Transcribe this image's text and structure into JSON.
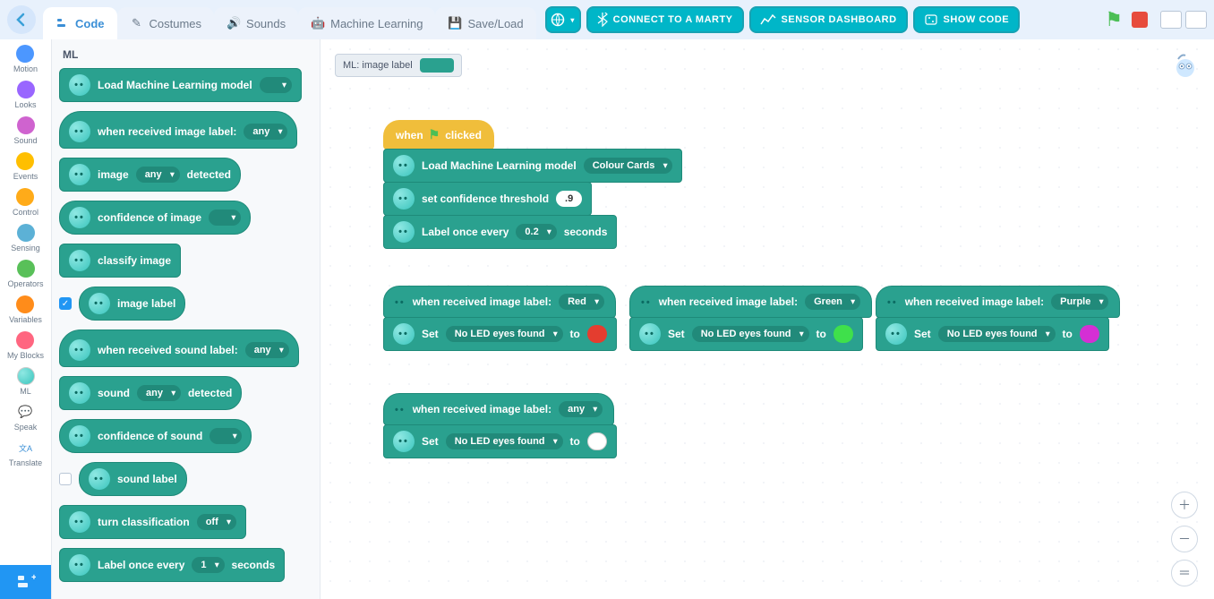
{
  "header": {
    "tabs": {
      "code": "Code",
      "costumes": "Costumes",
      "sounds": "Sounds",
      "ml": "Machine Learning",
      "saveload": "Save/Load"
    },
    "buttons": {
      "connect": "CONNECT TO A MARTY",
      "sensor": "SENSOR DASHBOARD",
      "showcode": "SHOW CODE"
    }
  },
  "rail": {
    "motion": "Motion",
    "looks": "Looks",
    "sound": "Sound",
    "events": "Events",
    "control": "Control",
    "sensing": "Sensing",
    "operators": "Operators",
    "variables": "Variables",
    "myblocks": "My Blocks",
    "ml": "ML",
    "speak": "Speak",
    "translate": "Translate"
  },
  "palette": {
    "title": "ML",
    "load_model": "Load Machine Learning model",
    "when_image": "when received image label:",
    "any": "any",
    "image": "image",
    "detected": "detected",
    "confidence_image": "confidence of image",
    "classify": "classify image",
    "image_label": "image label",
    "when_sound": "when received sound label:",
    "sound": "sound",
    "confidence_sound": "confidence of sound",
    "sound_label": "sound label",
    "turn_class": "turn classification",
    "off": "off",
    "label_every": "Label once every",
    "one": "1",
    "seconds": "seconds"
  },
  "canvas": {
    "monitor_label": "ML: image label",
    "when_clicked": {
      "when": "when",
      "clicked": "clicked"
    },
    "load_model": "Load Machine Learning model",
    "colour_cards": "Colour Cards",
    "set_conf": "set confidence threshold",
    "conf_val": ".9",
    "label_every": "Label once every",
    "interval": "0.2",
    "seconds": "seconds",
    "when_image": "when received image label:",
    "red": "Red",
    "green": "Green",
    "purple": "Purple",
    "any": "any",
    "set": "Set",
    "no_led": "No LED eyes found",
    "to": "to",
    "colors": {
      "red": "#e43d2f",
      "green": "#3fe04b",
      "purple": "#d42fd4",
      "white": "#ffffff"
    }
  }
}
